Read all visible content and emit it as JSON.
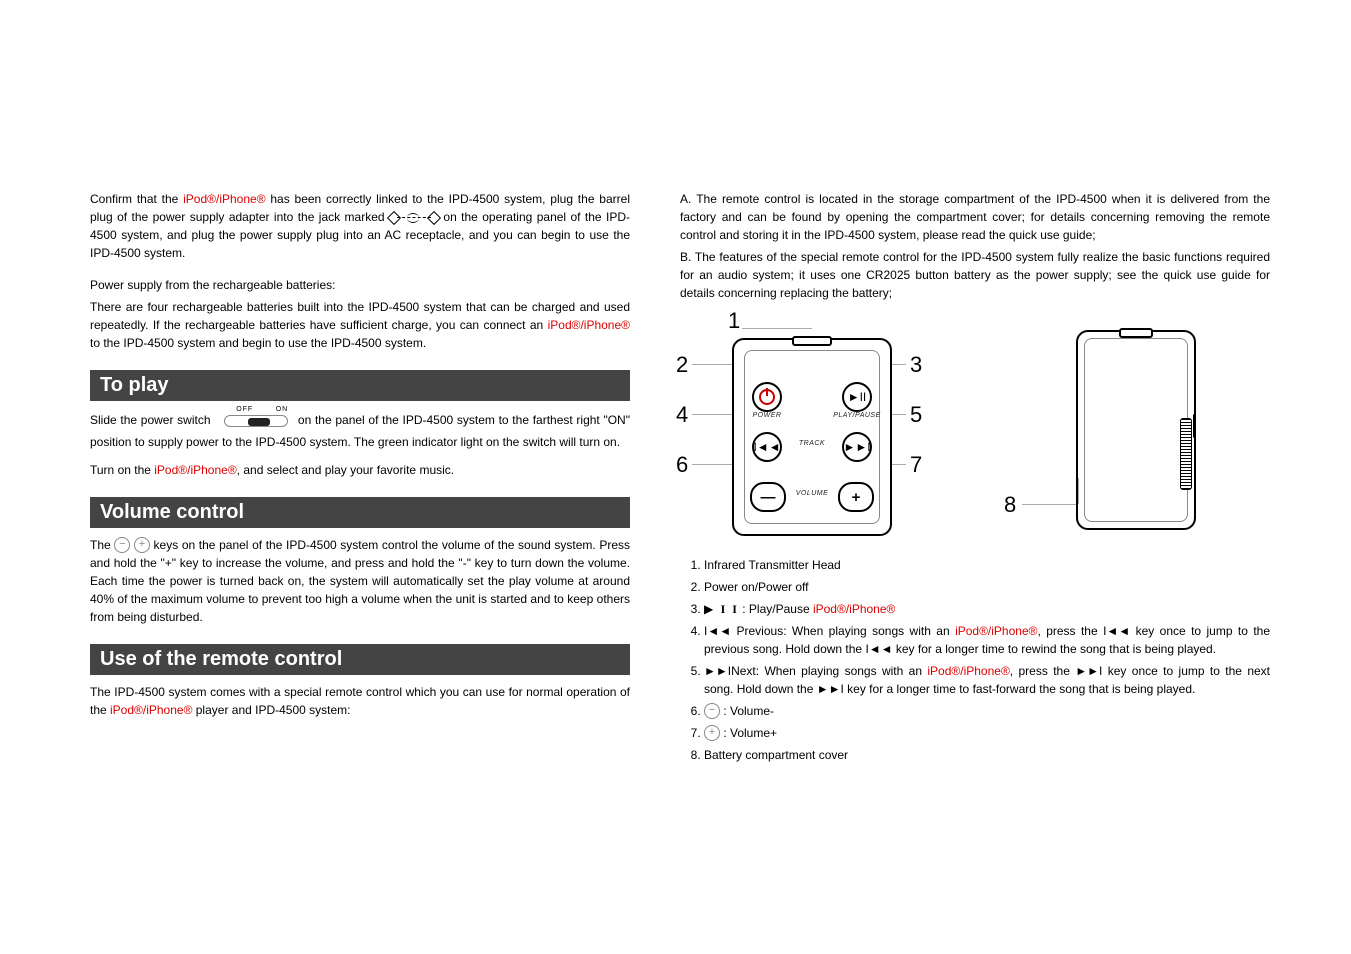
{
  "left": {
    "intro_a": "Confirm that the ",
    "intro_red": "iPod®/iPhone®",
    "intro_b": " has been correctly linked to the IPD-4500 system, plug the barrel plug of the power supply adapter into the jack marked ",
    "intro_c": " on the operating panel of the IPD-4500 system, and plug the power supply plug into an AC receptacle, and you can begin to use the IPD-4500 system.",
    "batt_title": "Power supply from the rechargeable batteries:",
    "batt_a": "There are four rechargeable batteries built into the IPD-4500 system that can be charged and used repeatedly. If the rechargeable batteries have sufficient charge, you can connect an ",
    "batt_red": "iPod®/iPhone®",
    "batt_b": " to the IPD-4500 system and begin to use the IPD-4500 system.",
    "play_header": "To play",
    "play_a": "Slide the power switch ",
    "play_b": " on the panel of the IPD-4500 system to the farthest right \"ON\" position to supply power to the IPD-4500 system. The green indicator light on the switch will turn on.",
    "play_c": "Turn on the ",
    "play_red": "iPod®/iPhone®",
    "play_d": ", and select and play your favorite music.",
    "vol_header": "Volume control",
    "vol_a": "The ",
    "vol_b": " keys on the panel of the IPD-4500 system control the volume of the sound system. Press and hold the \"+\" key to increase the volume, and press and hold the \"-\" key to turn down the volume. Each time the power is turned back on, the system will automatically set the play volume at around 40% of the maximum volume to prevent too high a volume when the unit is started and to keep others from being disturbed.",
    "rc_header": "Use of the remote control",
    "rc_a": "The IPD-4500 system comes with a special remote control which you can use for normal operation of the ",
    "rc_red": "iPod®/iPhone®",
    "rc_b": " player and IPD-4500 system:"
  },
  "right": {
    "a": "A. The remote control is located in the storage compartment of the IPD-4500 when it is delivered from the factory and can be found by opening the compartment cover; for details concerning removing the remote control and storing it in the IPD-4500 system, please read the quick use guide;",
    "b": "B. The features of the special remote control for the IPD-4500 system fully realize the basic functions required for an audio system; it uses one CR2025 button battery as the power supply; see the quick use guide for details concerning replacing the battery;",
    "remote": {
      "power": "POWER",
      "playpause": "PLAY/PAUSE",
      "track": "TRACK",
      "volume": "VOLUME"
    },
    "switch_off": "OFF",
    "switch_on": "ON",
    "nums": {
      "n1": "1",
      "n2": "2",
      "n3": "3",
      "n4": "4",
      "n5": "5",
      "n6": "6",
      "n7": "7",
      "n8": "8"
    },
    "legend": {
      "i1": "Infrared Transmitter Head",
      "i2": "Power on/Power off",
      "i3a": "  : Play/Pause ",
      "i3red": "iPod®/iPhone®",
      "i4a": " Previous: When playing songs with an ",
      "i4red": "iPod®/iPhone®",
      "i4b": ", press the ",
      "i4c": " key once to jump to the previous song. Hold down the ",
      "i4d": " key for a longer time to rewind the song that is being played.",
      "i5a": "Next: When playing songs with an ",
      "i5red": "iPod®/iPhone®",
      "i5b": ", press the ",
      "i5c": " key once to jump to the next song. Hold down the ",
      "i5d": " key for a longer time to fast-forward the song that is being played.",
      "i6": " : Volume-",
      "i7": " : Volume+",
      "i8": "Battery compartment cover"
    }
  }
}
